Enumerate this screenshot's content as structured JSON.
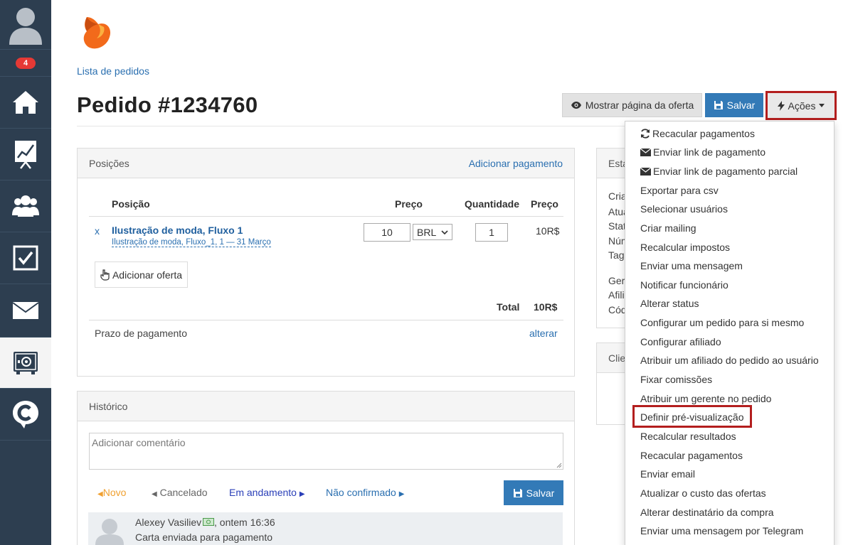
{
  "sidebar": {
    "badge_count": "4"
  },
  "breadcrumb": "Lista de pedidos",
  "title": "Pedido #1234760",
  "toolbar": {
    "show_offer": "Mostrar página da oferta",
    "save": "Salvar",
    "actions": "Ações"
  },
  "positions": {
    "heading": "Posições",
    "add_payment": "Adicionar pagamento",
    "columns": {
      "position": "Posição",
      "price": "Preço",
      "quantity": "Quantidade",
      "price_total": "Preço"
    },
    "item": {
      "remove": "x",
      "name": "Ilustração de moda, Fluxo 1",
      "subtitle": "Ilustração de moda, Fluxo_1, 1 — 31 Março",
      "price": "10",
      "currency": "BRL",
      "quantity": "1",
      "line_total": "10R$"
    },
    "add_offer": "Adicionar oferta",
    "total_label": "Total",
    "total_value": "10R$",
    "payment_term": "Prazo de pagamento",
    "change": "alterar"
  },
  "side_panel": {
    "heading_cut": "Esta",
    "rows_cut": [
      "Cria",
      "Atua",
      "Stat",
      "Núm",
      "Tags",
      "Gere",
      "Afilia",
      "Cód"
    ],
    "client_cut": "Clie"
  },
  "history": {
    "heading": "Histórico",
    "comment_placeholder": "Adicionar comentário",
    "statuses": {
      "novo": "Novo",
      "cancelado": "Cancelado",
      "andamento": "Em andamento",
      "nao_confirmado": "Não confirmado"
    },
    "save": "Salvar",
    "entry": {
      "author": "Alexey Vasiliev",
      "time": ", ontem 16:36",
      "text": "Carta enviada para pagamento"
    }
  },
  "actions_menu": [
    "Recacular pagamentos",
    "Enviar link de pagamento",
    "Enviar link de pagamento parcial",
    "Exportar para csv",
    "Selecionar usuários",
    "Criar mailing",
    "Recalcular impostos",
    "Enviar uma mensagem",
    "Notificar funcionário",
    "Alterar status",
    "Configurar um pedido para si mesmo",
    "Configurar afiliado",
    "Atribuir um afiliado do pedido ao usuário",
    "Fixar comissões",
    "Atribuir um gerente no pedido",
    "Definir pré-visualização",
    "Recalcular resultados",
    "Recacular pagamentos",
    "Enviar email",
    "Atualizar o custo das ofertas",
    "Alterar destinatário da compra",
    "Enviar uma mensagem por Telegram"
  ],
  "colors": {
    "sidebar": "#2d3e50",
    "primary": "#337ab7",
    "highlight": "#b31e1e",
    "link": "#2a6fb0",
    "status_novo": "#f0a030",
    "status_andamento": "#2a3fb8"
  }
}
